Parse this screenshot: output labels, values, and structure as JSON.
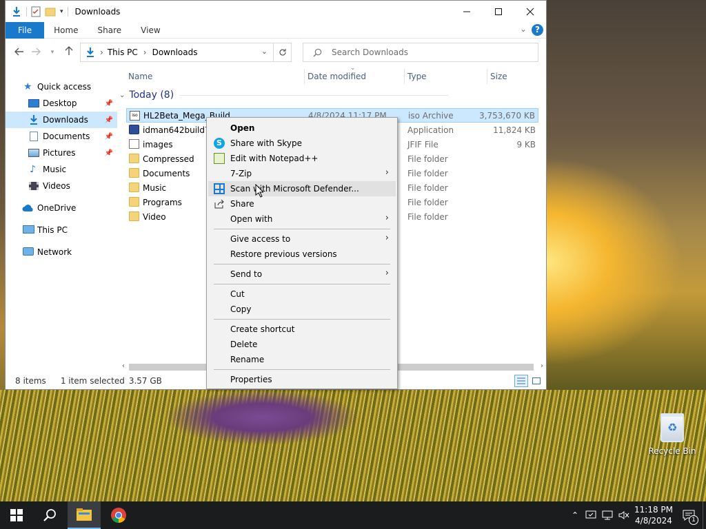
{
  "window": {
    "title": "Downloads",
    "ribbon_tabs": [
      "File",
      "Home",
      "Share",
      "View"
    ],
    "help": "?"
  },
  "address": {
    "segments": [
      "This PC",
      "Downloads"
    ],
    "separator": "›"
  },
  "search": {
    "placeholder": "Search Downloads"
  },
  "nav_pane": {
    "items": [
      {
        "label": "Quick access",
        "icon": "star-icon",
        "pinned": false
      },
      {
        "label": "Desktop",
        "icon": "desktop-icon",
        "pinned": true
      },
      {
        "label": "Downloads",
        "icon": "download-icon",
        "pinned": true,
        "selected": true
      },
      {
        "label": "Documents",
        "icon": "documents-icon",
        "pinned": true
      },
      {
        "label": "Pictures",
        "icon": "pictures-icon",
        "pinned": true
      },
      {
        "label": "Music",
        "icon": "music-icon",
        "pinned": false
      },
      {
        "label": "Videos",
        "icon": "videos-icon",
        "pinned": false
      },
      {
        "label": "OneDrive",
        "icon": "cloud-icon",
        "pinned": false
      },
      {
        "label": "This PC",
        "icon": "computer-icon",
        "pinned": false
      },
      {
        "label": "Network",
        "icon": "network-icon",
        "pinned": false
      }
    ]
  },
  "columns": {
    "name": "Name",
    "date": "Date modified",
    "type": "Type",
    "size": "Size"
  },
  "group": {
    "label": "Today (8)"
  },
  "files": [
    {
      "name": "HL2Beta_Mega_Build",
      "date": "4/8/2024 11:17 PM",
      "type": "iso Archive",
      "size": "3,753,670 KB",
      "icon": "iso-file-icon",
      "selected": true
    },
    {
      "name": "idman642build7",
      "date": "",
      "type": "Application",
      "size": "11,824 KB",
      "icon": "application-icon"
    },
    {
      "name": "images",
      "date": "",
      "type": "JFIF File",
      "size": "9 KB",
      "icon": "image-file-icon"
    },
    {
      "name": "Compressed",
      "date": "",
      "type": "File folder",
      "size": "",
      "icon": "folder-icon"
    },
    {
      "name": "Documents",
      "date": "",
      "type": "File folder",
      "size": "",
      "icon": "folder-icon"
    },
    {
      "name": "Music",
      "date": "",
      "type": "File folder",
      "size": "",
      "icon": "folder-icon"
    },
    {
      "name": "Programs",
      "date": "",
      "type": "File folder",
      "size": "",
      "icon": "folder-icon"
    },
    {
      "name": "Video",
      "date": "",
      "type": "File folder",
      "size": "",
      "icon": "folder-icon"
    }
  ],
  "status": {
    "count": "8 items",
    "selection": "1 item selected",
    "size": "3.57 GB"
  },
  "context_menu": {
    "items": [
      {
        "label": "Open",
        "bold": true
      },
      {
        "label": "Share with Skype",
        "icon": "skype-icon"
      },
      {
        "label": "Edit with Notepad++",
        "icon": "notepadpp-icon"
      },
      {
        "label": "7-Zip",
        "submenu": true
      },
      {
        "label": "Scan with Microsoft Defender...",
        "icon": "defender-icon",
        "hover": true
      },
      {
        "label": "Share",
        "icon": "share-icon"
      },
      {
        "label": "Open with",
        "submenu": true
      },
      {
        "separator": true
      },
      {
        "label": "Give access to",
        "submenu": true
      },
      {
        "label": "Restore previous versions"
      },
      {
        "separator": true
      },
      {
        "label": "Send to",
        "submenu": true
      },
      {
        "separator": true
      },
      {
        "label": "Cut"
      },
      {
        "label": "Copy"
      },
      {
        "separator": true
      },
      {
        "label": "Create shortcut"
      },
      {
        "label": "Delete"
      },
      {
        "label": "Rename"
      },
      {
        "separator": true
      },
      {
        "label": "Properties"
      }
    ]
  },
  "desktop": {
    "recycle_bin": "Recycle Bin"
  },
  "taskbar": {
    "time": "11:18 PM",
    "date": "4/8/2024",
    "notifications": "1"
  },
  "colors": {
    "accent": "#1979ca",
    "selection": "#cce8ff",
    "folder": "#f4d37a",
    "taskbar": "#1a1c1e"
  }
}
